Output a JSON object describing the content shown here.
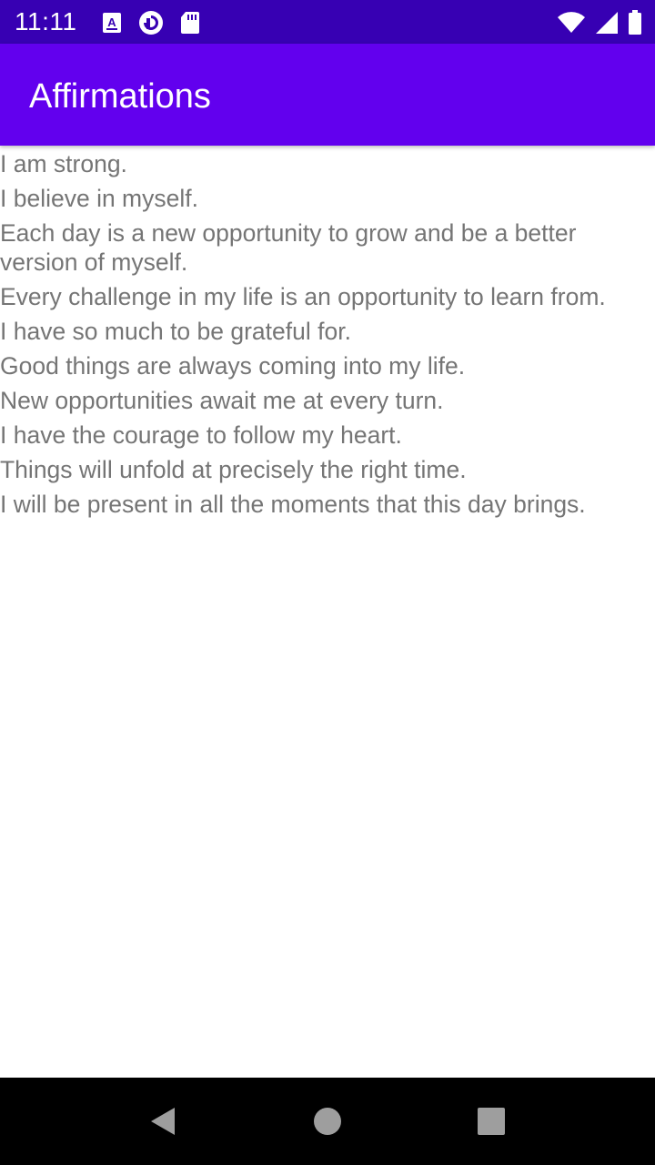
{
  "status_bar": {
    "time": "11:11",
    "left_icons": [
      "a11y-icon",
      "pocket-casts-icon",
      "sd-card-icon"
    ],
    "right_icons": [
      "wifi-icon",
      "cell-signal-icon",
      "battery-icon"
    ]
  },
  "app_bar": {
    "title": "Affirmations"
  },
  "affirmations": [
    "I am strong.",
    "I believe in myself.",
    "Each day is a new opportunity to grow and be a better version of myself.",
    "Every challenge in my life is an opportunity to learn from.",
    "I have so much to be grateful for.",
    "Good things are always coming into my life.",
    "New opportunities await me at every turn.",
    "I have the courage to follow my heart.",
    "Things will unfold at precisely the right time.",
    "I will be present in all the moments that this day brings."
  ],
  "nav_bar": {
    "buttons": [
      "back-icon",
      "home-icon",
      "recents-icon"
    ]
  },
  "colors": {
    "status_bar": "#3700b3",
    "app_bar": "#6200ee",
    "text": "#757575",
    "nav_bar": "#000000",
    "nav_icons": "#9e9e9e"
  }
}
